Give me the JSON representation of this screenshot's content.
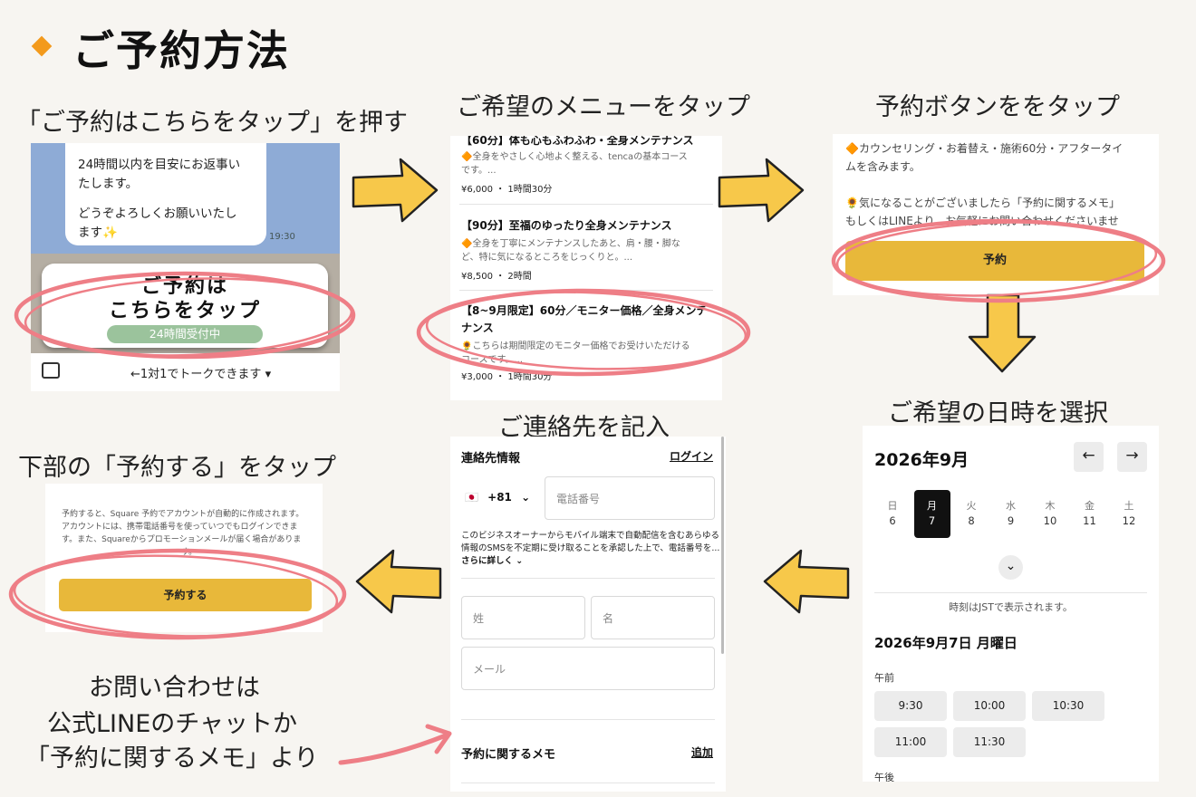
{
  "title": "ご予約方法",
  "captions": {
    "step1": "「ご予約はこちらをタップ」を押す",
    "step2": "ご希望のメニューをタップ",
    "step3": "予約ボタンををタップ",
    "step4": "ご希望の日時を選択",
    "step5": "ご連絡先を記入",
    "step6": "下部の「予約する」をタップ"
  },
  "note": {
    "line1": "お問い合わせは",
    "line2": "公式LINEのチャットか",
    "line3": "「予約に関するメモ」より"
  },
  "line_chat": {
    "bubble_line1": "24時間以内を目安にお返事い",
    "bubble_line2": "たします。",
    "bubble_line3": "どうぞよろしくお願いいたし",
    "bubble_line4": "ます✨",
    "time": "19:30",
    "rich_line1": "ご予約は",
    "rich_line2": "こちらをタップ",
    "rich_badge": "24時間受付中",
    "footer": "←1対1でトークできます ▾"
  },
  "menus": [
    {
      "title": "【60分】体も心もふわふわ・全身メンテナンス",
      "desc_line1": "🔶全身をやさしく心地よく整える、tencaの基本コース",
      "desc_line2": "です。...",
      "meta": "¥6,000 ・ 1時間30分"
    },
    {
      "title": "【90分】至福のゆったり全身メンテナンス",
      "desc_line1": "🔶全身を丁寧にメンテナンスしたあと、肩・腰・脚な",
      "desc_line2": "ど、特に気になるところをじっくりと。...",
      "meta": "¥8,500 ・ 2時間"
    },
    {
      "title_line1": "【8~9月限定】60分／モニター価格／全身メンテ",
      "title_line2": "ナンス",
      "desc_line1": "🌻こちらは期間限定のモニター価格でお受けいただける",
      "desc_line2": "コースです。...",
      "meta": "¥3,000 ・ 1時間30分"
    }
  ],
  "booking_detail": {
    "line1": "🔶カウンセリング・お着替え・施術60分・アフタータイ",
    "line2": "ムを含みます。",
    "line3": "🌻気になることがございましたら「予約に関するメモ」",
    "line4": "もしくはLINEより、お気軽にお問い合わせくださいませ",
    "button": "予約"
  },
  "calendar": {
    "month": "2026年9月",
    "prev": "←",
    "next": "→",
    "days": [
      {
        "dow": "日",
        "num": "6"
      },
      {
        "dow": "月",
        "num": "7"
      },
      {
        "dow": "火",
        "num": "8"
      },
      {
        "dow": "水",
        "num": "9"
      },
      {
        "dow": "木",
        "num": "10"
      },
      {
        "dow": "金",
        "num": "11"
      },
      {
        "dow": "土",
        "num": "12"
      }
    ],
    "selected_index": 1,
    "expand": "⌄",
    "tz_note": "時刻はJSTで表示されます。",
    "date_heading": "2026年9月7日 月曜日",
    "am_label": "午前",
    "slots": [
      "9:30",
      "10:00",
      "10:30",
      "11:00",
      "11:30"
    ],
    "pm_label": "午後"
  },
  "contact": {
    "heading": "連絡先情報",
    "login": "ログイン",
    "flag": "🇯🇵",
    "country_code": "+81",
    "phone_placeholder": "電話番号",
    "consent_line1": "このビジネスオーナーからモバイル端末で自動配信を含むあらゆる",
    "consent_line2": "情報のSMSを不定期に受け取ることを承認した上で、電話番号を...",
    "more": "さらに詳しく ⌄",
    "last_name": "姓",
    "first_name": "名",
    "email": "メール",
    "memo_label": "予約に関するメモ",
    "memo_add": "追加"
  },
  "final": {
    "line1": "予約すると、Square 予約でアカウントが自動的に作成されます。",
    "line2": "アカウントには、携帯電話番号を使っていつでもログインできま",
    "line3": "す。また、Squareからプロモーションメールが届く場合がありま",
    "line4": "す。",
    "button": "予約する"
  },
  "colors": {
    "accent_yellow": "#e8b83a",
    "arrow_yellow": "#f7c84a",
    "ring_pink": "#ee7e86",
    "diamond_orange": "#f39a1c",
    "badge_green": "#9bc39c"
  }
}
